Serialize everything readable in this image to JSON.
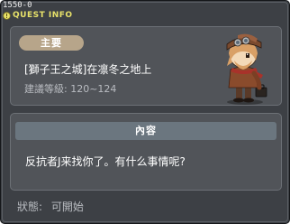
{
  "window": {
    "quest_id": "1550-0",
    "title": "QUEST INFO",
    "title_icon": "quest-info-icon"
  },
  "info": {
    "category": "主要",
    "quest_name": "[獅子王之城]在凛冬之地上",
    "recommended_level": "建議等級: 120~124",
    "npc_portrait": "npc-character-portrait"
  },
  "content": {
    "header": "內容",
    "dialogue": "反抗者J来找你了。有什么事情呢?"
  },
  "status": {
    "label": "狀態:",
    "value": "可開始"
  },
  "colors": {
    "window_bg": "#3d4045",
    "panel_bg": "#515459",
    "title_yellow": "#e8e26a",
    "badge_tan": "#b7a58a",
    "header_slate": "#6b767f",
    "muted_text": "#b9bcc1"
  }
}
